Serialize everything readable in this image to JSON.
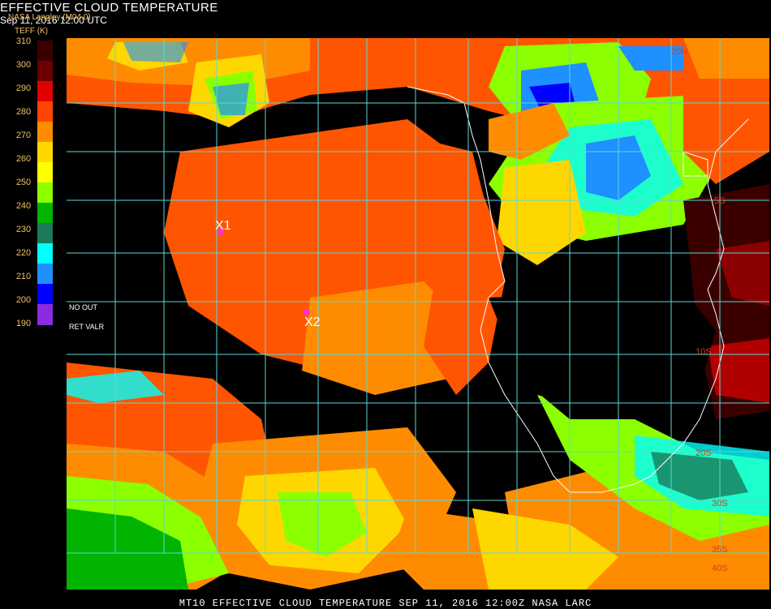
{
  "header": {
    "title": "EFFECTIVE CLOUD TEMPERATURE",
    "subtitle": "Sep 11, 2016 12:00 UTC",
    "agency": "NASA Langley (M04.0)",
    "units": "TEFF (K)"
  },
  "legend": {
    "ticks": [
      "310",
      "300",
      "290",
      "280",
      "270",
      "260",
      "250",
      "240",
      "230",
      "220",
      "210",
      "200",
      "190"
    ],
    "colors": [
      "#3a0000",
      "#6b0000",
      "#e00000",
      "#ff4400",
      "#ff8c00",
      "#ffd700",
      "#ffff00",
      "#8cff00",
      "#00b400",
      "#1a7a5a",
      "#00ffff",
      "#1e90ff",
      "#0000ff",
      "#8a2be2"
    ],
    "no_out": "NO   OUT",
    "ret_valr": "RET   VALR"
  },
  "map": {
    "markers": [
      {
        "id": "X1",
        "label": "X1"
      },
      {
        "id": "X2",
        "label": "X2"
      }
    ],
    "lat_labels": [
      "20N",
      "5S",
      "10S",
      "20S",
      "30S",
      "35S",
      "40S"
    ],
    "colors": {
      "grid": "#5ad8d8",
      "coast": "#ffffff",
      "marker": "#ff2fd0",
      "clear": "#000000"
    }
  },
  "footer": {
    "text": "MT10  EFFECTIVE CLOUD TEMPERATURE   SEP 11, 2016 12:00Z   NASA LARC"
  }
}
